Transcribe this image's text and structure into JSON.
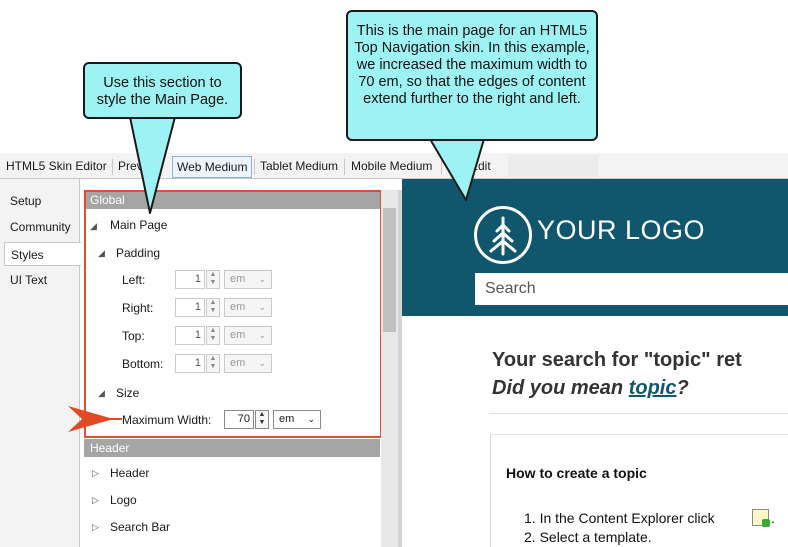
{
  "callouts": {
    "left": "Use this section to style the Main Page.",
    "right": "This is the main page for an HTML5 Top Navigation skin. In this example, we increased the maximum width to 70 em, so that the edges of content extend further to the right and left."
  },
  "tabs": [
    {
      "label": "HTML5 Skin Editor"
    },
    {
      "label": "Preview"
    },
    {
      "label": "Web Medium"
    },
    {
      "label": "Tablet Medium"
    },
    {
      "label": "Mobile Medium"
    },
    {
      "label": "Edit"
    }
  ],
  "leftnav": {
    "items": [
      {
        "label": "Setup"
      },
      {
        "label": "Community"
      },
      {
        "label": "Styles"
      },
      {
        "label": "UI Text"
      }
    ],
    "active": "Styles"
  },
  "properties": {
    "global_header": "Global",
    "main_page": "Main Page",
    "padding": "Padding",
    "left_label": "Left:",
    "left_value": "1",
    "left_unit": "em",
    "right_label": "Right:",
    "right_value": "1",
    "right_unit": "em",
    "top_label": "Top:",
    "top_value": "1",
    "top_unit": "em",
    "bottom_label": "Bottom:",
    "bottom_value": "1",
    "bottom_unit": "em",
    "size": "Size",
    "max_width_label": "Maximum Width:",
    "max_width_value": "70",
    "max_width_unit": "em",
    "header_group": "Header",
    "header_item": "Header",
    "logo_item": "Logo",
    "search_bar_item": "Search Bar"
  },
  "preview": {
    "logo_text": "YOUR LOGO",
    "search_placeholder": "Search",
    "results_title": "Your search for \"topic\" ret",
    "did_you_mean_prefix": "Did you mean ",
    "did_you_mean_link": "topic",
    "did_you_mean_suffix": "?",
    "result_heading": "How to create a topic",
    "step1": "1.  In the Content Explorer click",
    "step1_end": ".",
    "step2": "2.  Select a template."
  },
  "colors": {
    "preview_header": "#10576e",
    "callout_fill": "#9df3f3",
    "highlight_border": "#e0502e",
    "group_header": "#a5a5a5"
  }
}
